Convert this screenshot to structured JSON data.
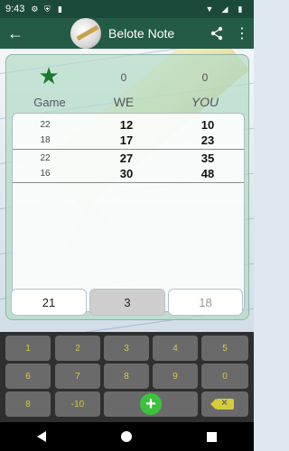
{
  "status": {
    "time": "9:43"
  },
  "appbar": {
    "title": "Belote Note"
  },
  "header": {
    "score_we": "0",
    "score_you": "0",
    "label_game": "Game",
    "label_we": "WE",
    "label_you": "YOU"
  },
  "rows": [
    {
      "game": "22",
      "we": "12",
      "you": "10"
    },
    {
      "game": "18",
      "we": "17",
      "you": "23"
    },
    {
      "game": "22",
      "we": "27",
      "you": "35"
    },
    {
      "game": "16",
      "we": "30",
      "you": "48"
    }
  ],
  "entry": {
    "left": "21",
    "middle": "3",
    "right": "18"
  },
  "keys": {
    "k1": "1",
    "k2": "2",
    "k3": "3",
    "k4": "4",
    "k5": "5",
    "k6": "6",
    "k7": "7",
    "k8": "8",
    "k9": "9",
    "k0": "0",
    "k8b": "8",
    "kminus10": "-10"
  },
  "colors": {
    "appbar": "#245b47",
    "accent_star": "#1a7a2c",
    "key_text": "#d4cc3a",
    "add_button": "#3cc23c"
  }
}
